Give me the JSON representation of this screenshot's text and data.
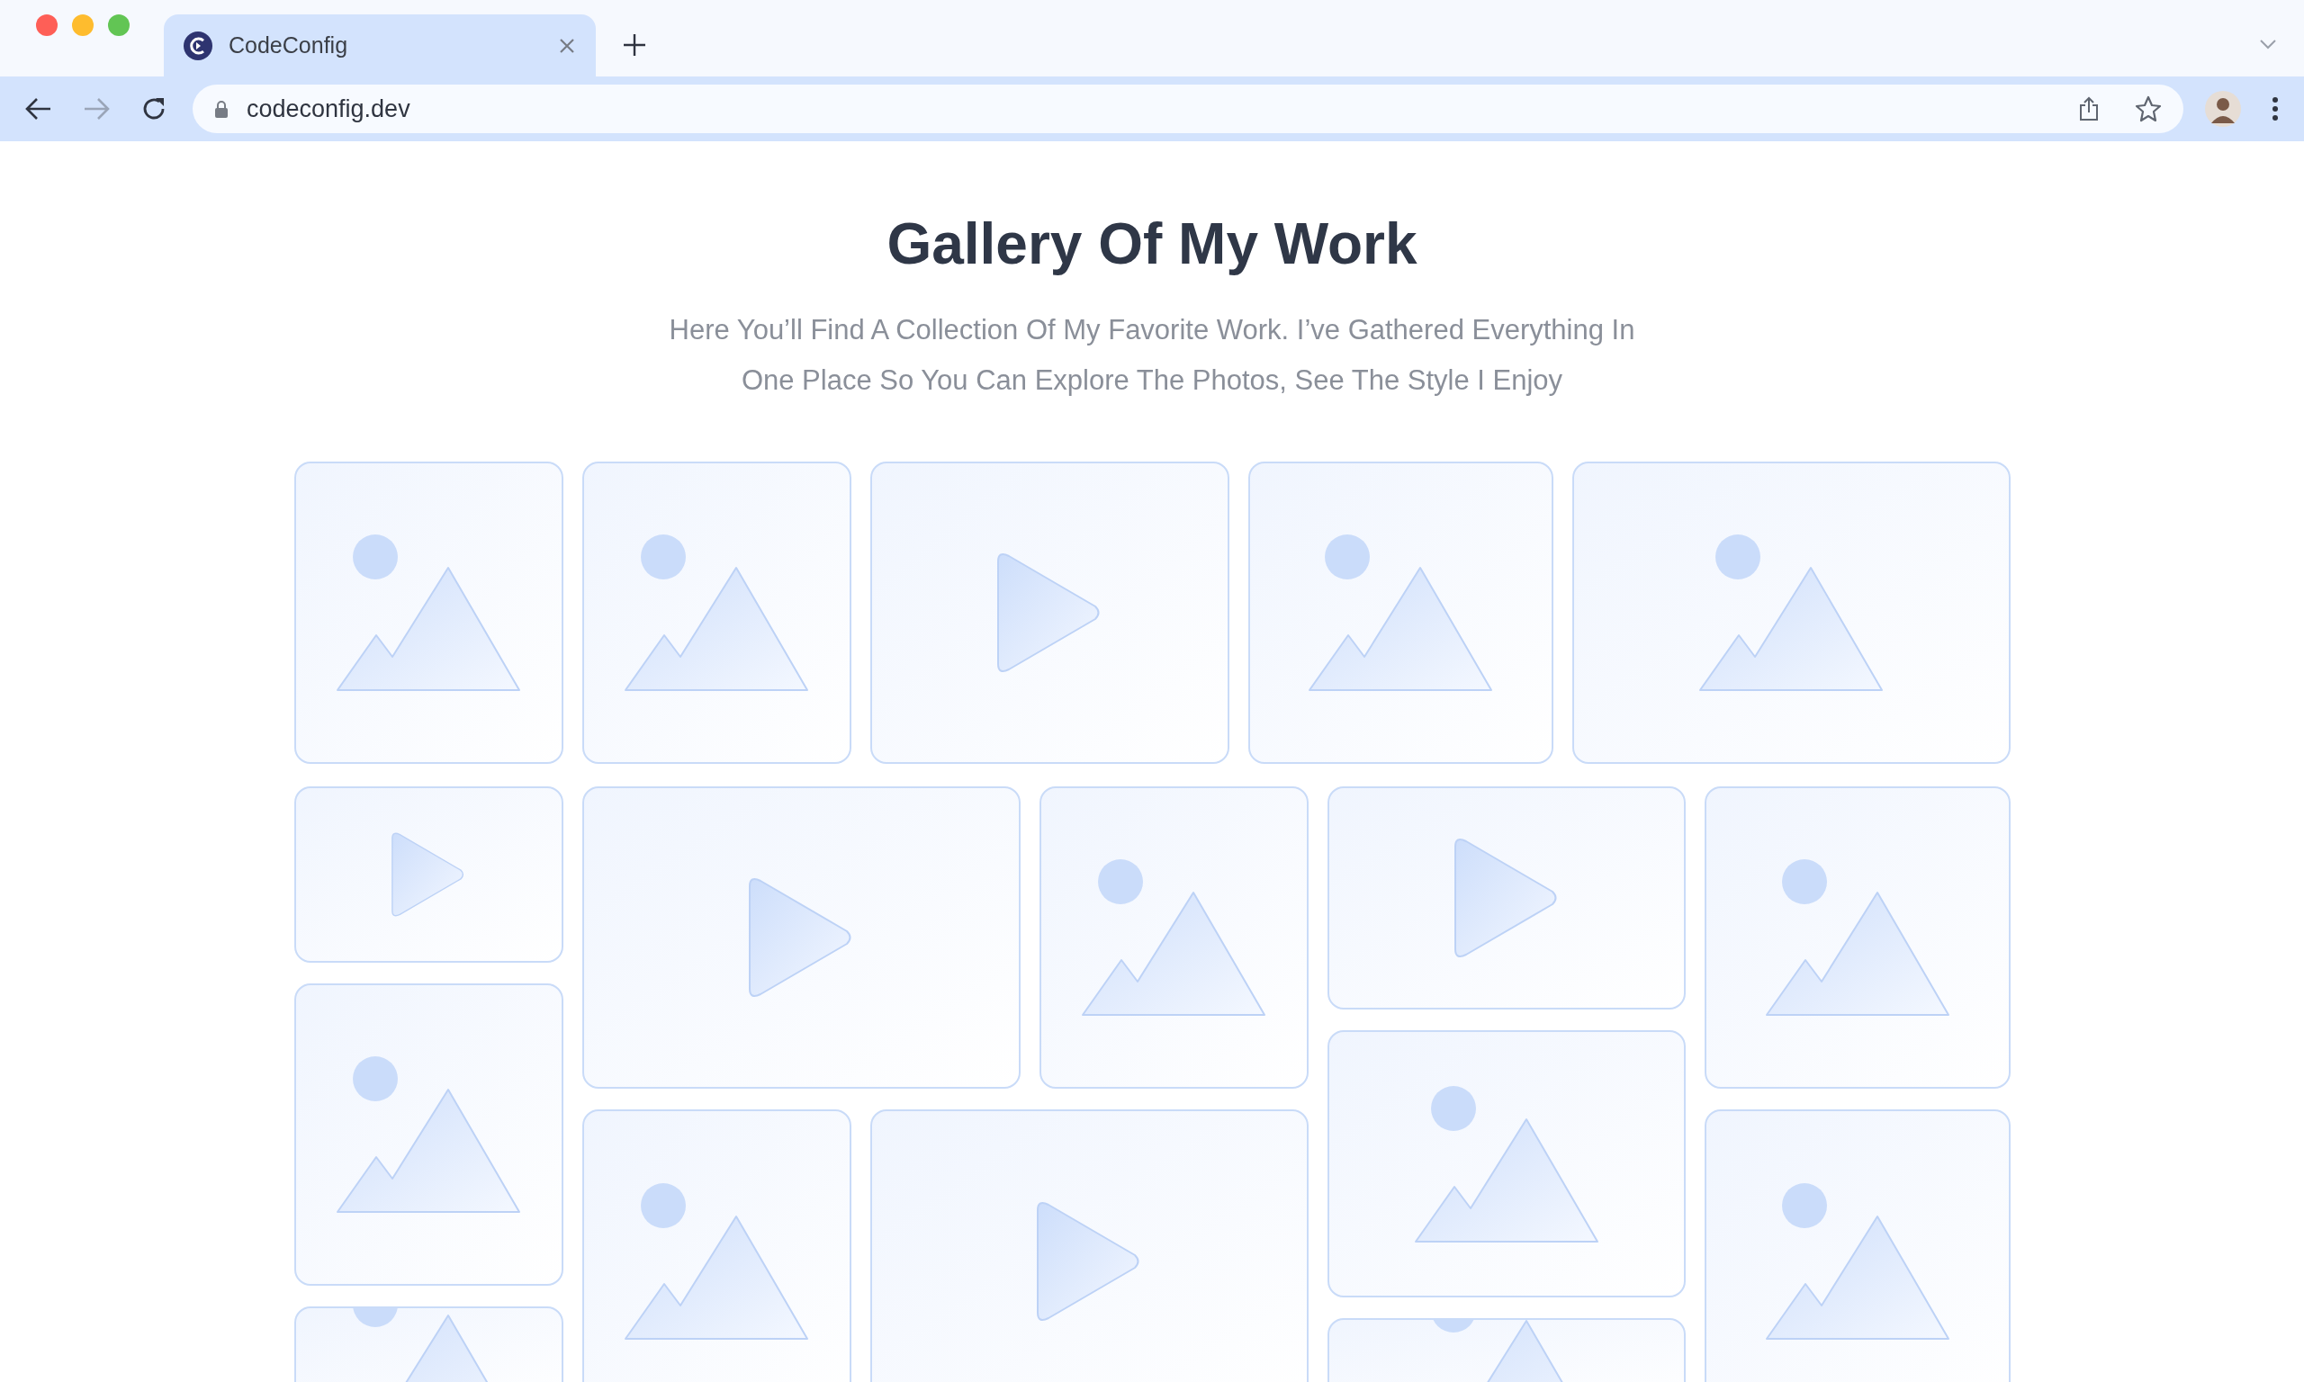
{
  "browser": {
    "tab": {
      "title": "CodeConfig",
      "selected": true
    },
    "url": "codeconfig.dev"
  },
  "gallery": {
    "title": "Gallery Of My Work",
    "subtitle_lines": [
      "Here You’ll Find A Collection Of My Favorite Work. I’ve Gathered Everything In",
      "One Place So You Can Explore The Photos, See The Style I Enjoy"
    ],
    "tiles": [
      {
        "kind": "image"
      },
      {
        "kind": "image"
      },
      {
        "kind": "video"
      },
      {
        "kind": "image"
      },
      {
        "kind": "image"
      },
      {
        "kind": "video"
      },
      {
        "kind": "video"
      },
      {
        "kind": "image"
      },
      {
        "kind": "video"
      },
      {
        "kind": "image"
      },
      {
        "kind": "image"
      },
      {
        "kind": "image"
      },
      {
        "kind": "image"
      },
      {
        "kind": "video"
      },
      {
        "kind": "image"
      },
      {
        "kind": "image"
      },
      {
        "kind": "image"
      }
    ]
  }
}
